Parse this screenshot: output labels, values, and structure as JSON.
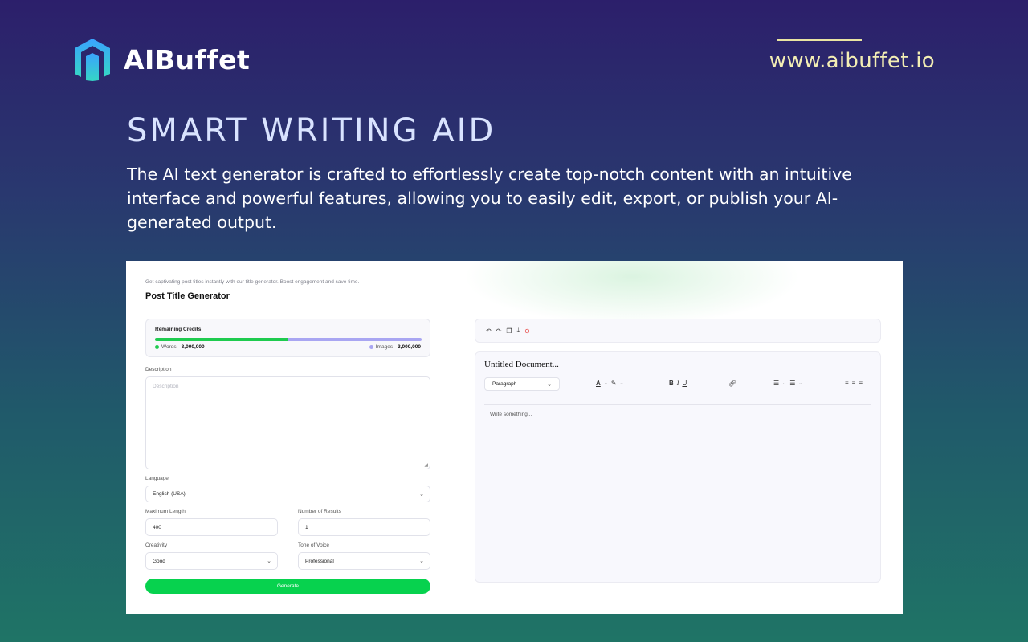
{
  "brand": {
    "name": "AIBuffet",
    "url": "www.aibuffet.io"
  },
  "hero": {
    "title": "SMART WRITING AID",
    "description": "The AI text generator is crafted to effortlessly create top-notch content with an intuitive interface and powerful features, allowing you to easily edit, export, or publish your AI-generated output."
  },
  "app": {
    "subtitle": "Get captivating post titles instantly with our title generator. Boost engagement and save time.",
    "title": "Post Title Generator",
    "credits": {
      "label": "Remaining Credits",
      "words_label": "Words",
      "words_value": "3,000,000",
      "images_label": "Images",
      "images_value": "3,000,000",
      "words_share": 0.5,
      "images_share": 0.5
    },
    "form": {
      "description_label": "Description",
      "description_placeholder": "Description",
      "language_label": "Language",
      "language_value": "English (USA)",
      "max_length_label": "Maximum Length",
      "max_length_value": "400",
      "results_label": "Number of Results",
      "results_value": "1",
      "creativity_label": "Creativity",
      "creativity_value": "Good",
      "tone_label": "Tone of Voice",
      "tone_value": "Professional",
      "generate_label": "Generate"
    },
    "editor": {
      "toolbar_icons": [
        "undo-icon",
        "redo-icon",
        "copy-icon",
        "download-icon",
        "delete-icon"
      ],
      "document_title": "Untitled Document...",
      "block_type": "Paragraph",
      "placeholder": "Write something..."
    }
  },
  "colors": {
    "words_bar": "#1fcb4f",
    "images_bar": "#a9a6f2",
    "generate_button": "#07d24e",
    "url_text": "#f3eeb4"
  }
}
